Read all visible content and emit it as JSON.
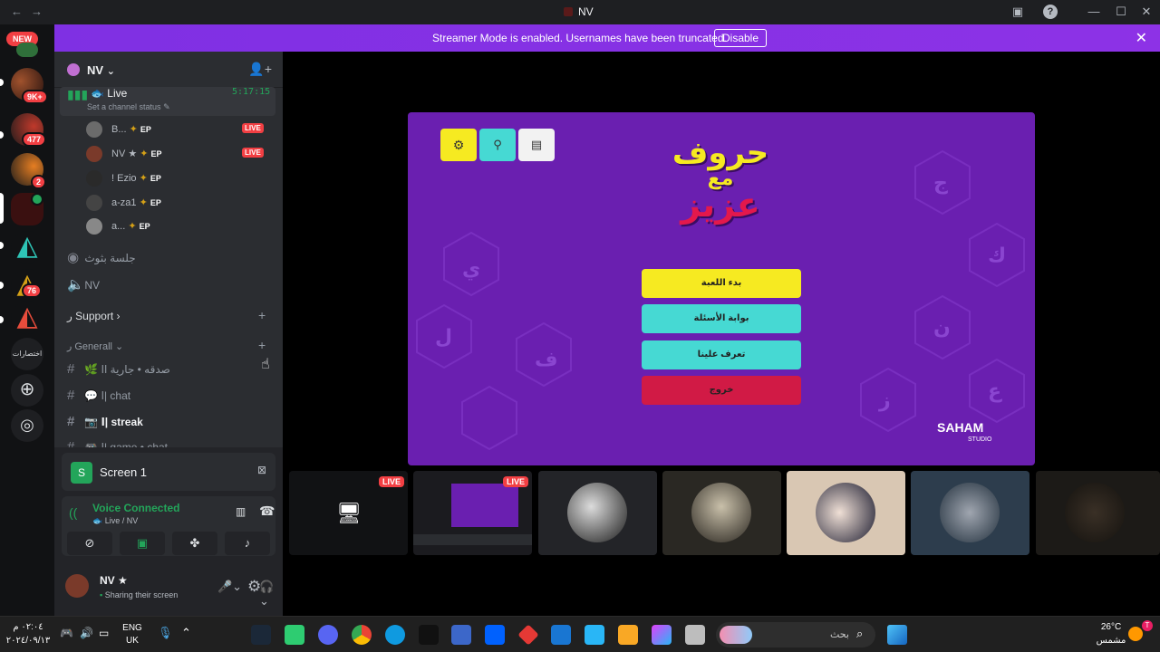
{
  "titlebar": {
    "title": "NV",
    "back": "←",
    "forward": "→",
    "minimize": "—",
    "maximize": "☐",
    "close": "✕",
    "help": "?"
  },
  "rail": {
    "new_label": "NEW",
    "badges": [
      "9K+",
      "477",
      "2",
      "76"
    ],
    "discover_label": "اختصارات"
  },
  "banner": {
    "message": "Streamer Mode is enabled. Usernames have been truncated.",
    "disable": "Disable",
    "close": "✕"
  },
  "server": {
    "name": "NV",
    "chevron": "⌄"
  },
  "live_channel": {
    "name": "Live",
    "timer": "5:17:15",
    "status_placeholder": "Set a channel status"
  },
  "voice_users": [
    {
      "name": "B...",
      "badge": "EP",
      "live": "LIVE"
    },
    {
      "name": "NV ★",
      "badge": "EP",
      "live": "LIVE"
    },
    {
      "name": "! Ezio",
      "badge": "EP",
      "live": ""
    },
    {
      "name": "a-za1",
      "badge": "EP",
      "live": ""
    },
    {
      "name": "a...",
      "badge": "EP",
      "live": ""
    }
  ],
  "channels": {
    "stage": "جلسة بثوث",
    "voice": "NV",
    "support_category": "Support",
    "general_category": "Generall",
    "text": [
      {
        "emoji": "🌿",
        "name": "صدقه • جارية اا"
      },
      {
        "emoji": "💬",
        "name": "ا| chat"
      },
      {
        "emoji": "📷",
        "name": "ا| streak"
      },
      {
        "emoji": "🎮",
        "name": "ا| game • chat"
      }
    ]
  },
  "panel": {
    "screen_title": "Screen 1",
    "voice_status": "Voice Connected",
    "voice_location": "Live / NV",
    "user_name": "NV ★",
    "user_status": "Sharing their screen"
  },
  "game": {
    "title_lines": [
      "حروف",
      "مع",
      "عزيز"
    ],
    "buttons": [
      "بدء اللعبة",
      "بوابة الأسئلة",
      "تعرف علينا",
      "خروج"
    ],
    "studio": "SAHAM",
    "studio_sub": "STUDIO"
  },
  "tiles": [
    {
      "live": "LIVE"
    },
    {
      "live": "LIVE"
    }
  ],
  "taskbar": {
    "time": "٠٢:٠٤ م",
    "date": "٢٠٢٤/٠٩/١٣",
    "lang_top": "ENG",
    "lang_bottom": "UK",
    "search_placeholder": "بحث",
    "weather_temp": "26°C",
    "weather_desc": "مشمس"
  },
  "colors": {
    "accent": "#8d32e6",
    "live": "#f23f43",
    "green": "#23a55a",
    "yellow": "#f6ea21",
    "teal": "#46d9d3",
    "red": "#d11a45"
  }
}
